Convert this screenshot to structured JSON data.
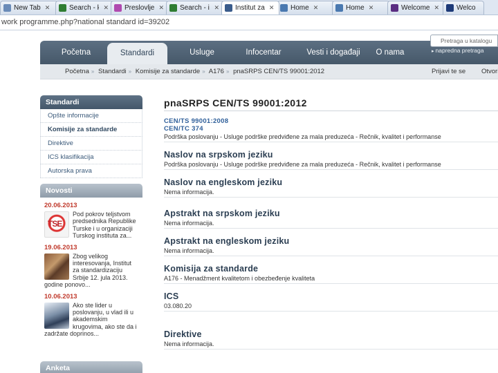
{
  "browser": {
    "tabs": [
      {
        "label": "New Tab",
        "icon": "page-icon",
        "color": "#6a8bb8"
      },
      {
        "label": "Search - k",
        "icon": "search-icon",
        "color": "#2f7d32"
      },
      {
        "label": "Preslovljev",
        "icon": "s-logo-icon",
        "color": "#b04ab0"
      },
      {
        "label": "Search - in",
        "icon": "search-icon",
        "color": "#2f7d32"
      },
      {
        "label": "Institut za",
        "icon": "institute-icon",
        "color": "#3a5c8c"
      },
      {
        "label": "Home",
        "icon": "mail-icon",
        "color": "#4a79b0"
      },
      {
        "label": "Home",
        "icon": "mail-icon",
        "color": "#4a79b0"
      },
      {
        "label": "Welcome",
        "icon": "flag-icon",
        "color": "#5a2d82"
      },
      {
        "label": "Welco",
        "icon": "e-logo-icon",
        "color": "#1d3a78"
      }
    ],
    "address": "work programme.php?national standard id=39202"
  },
  "nav": {
    "items": [
      "Početna",
      "Standardi",
      "Usluge",
      "Infocentar",
      "Vesti i događaji",
      "O nama"
    ],
    "active": "Standardi",
    "catalog_placeholder": "Pretraga u katalogu",
    "advanced_search": "napredna pretraga"
  },
  "breadcrumb": [
    "Početna",
    "Standardi",
    "Komisije za standarde",
    "A176",
    "pnaSRPS CEN/TS 99001:2012"
  ],
  "subbar_links": [
    "Prijavi te se",
    "Otvori"
  ],
  "sidebar": {
    "title": "Standardi",
    "items": [
      "Opšte informacije",
      "Komisije za standarde",
      "Direktive",
      "ICS klasifikacija",
      "Autorska prava"
    ],
    "current": "Komisije za standarde",
    "news_title": "Novosti",
    "news": [
      {
        "date": "20.06.2013",
        "text": "Pod pokrov teljstvom predsednika Republike Turske i u organizaciji Turskog instituta za..."
      },
      {
        "date": "19.06.2013",
        "text": "Zbog velikog interesovanja, Institut za standardizaciju Srbije 12. jula 2013. godine ponovo..."
      },
      {
        "date": "10.06.2013",
        "text": "Ako ste lider u poslovanju, u vlad ili u akademskim krugovima, ako ste da i zadržate doprinos..."
      }
    ],
    "poll_title": "Anketa",
    "thumb1_text": "TSE"
  },
  "main": {
    "title": "pnaSRPS CEN/TS 99001:2012",
    "refs": [
      "CEN/TS 99001:2008",
      "CEN/TC 374"
    ],
    "ref_text": "Podrška poslovanju - Usluge podrške predviđene za mala preduzeća - Rečnik, kvalitet i performanse",
    "sections": [
      {
        "title": "Naslov na srpskom jeziku",
        "text": "Podrška poslovanju - Usluge podrške predviđene za mala preduzeća - Rečnik, kvalitet i performanse"
      },
      {
        "title": "Naslov na engleskom jeziku",
        "text": "Nema informacija."
      },
      {
        "title": "Apstrakt na srpskom jeziku",
        "text": "Nema informacija."
      },
      {
        "title": "Apstrakt na engleskom jeziku",
        "text": "Nema informacija."
      },
      {
        "title": "Komisija za standarde",
        "text": "A176 - Menadžment kvalitetom i obezbeđenje kvaliteta"
      },
      {
        "title": "ICS",
        "text": "03.080.20"
      },
      {
        "title": "Direktive",
        "text": "Nema informacija."
      }
    ]
  }
}
